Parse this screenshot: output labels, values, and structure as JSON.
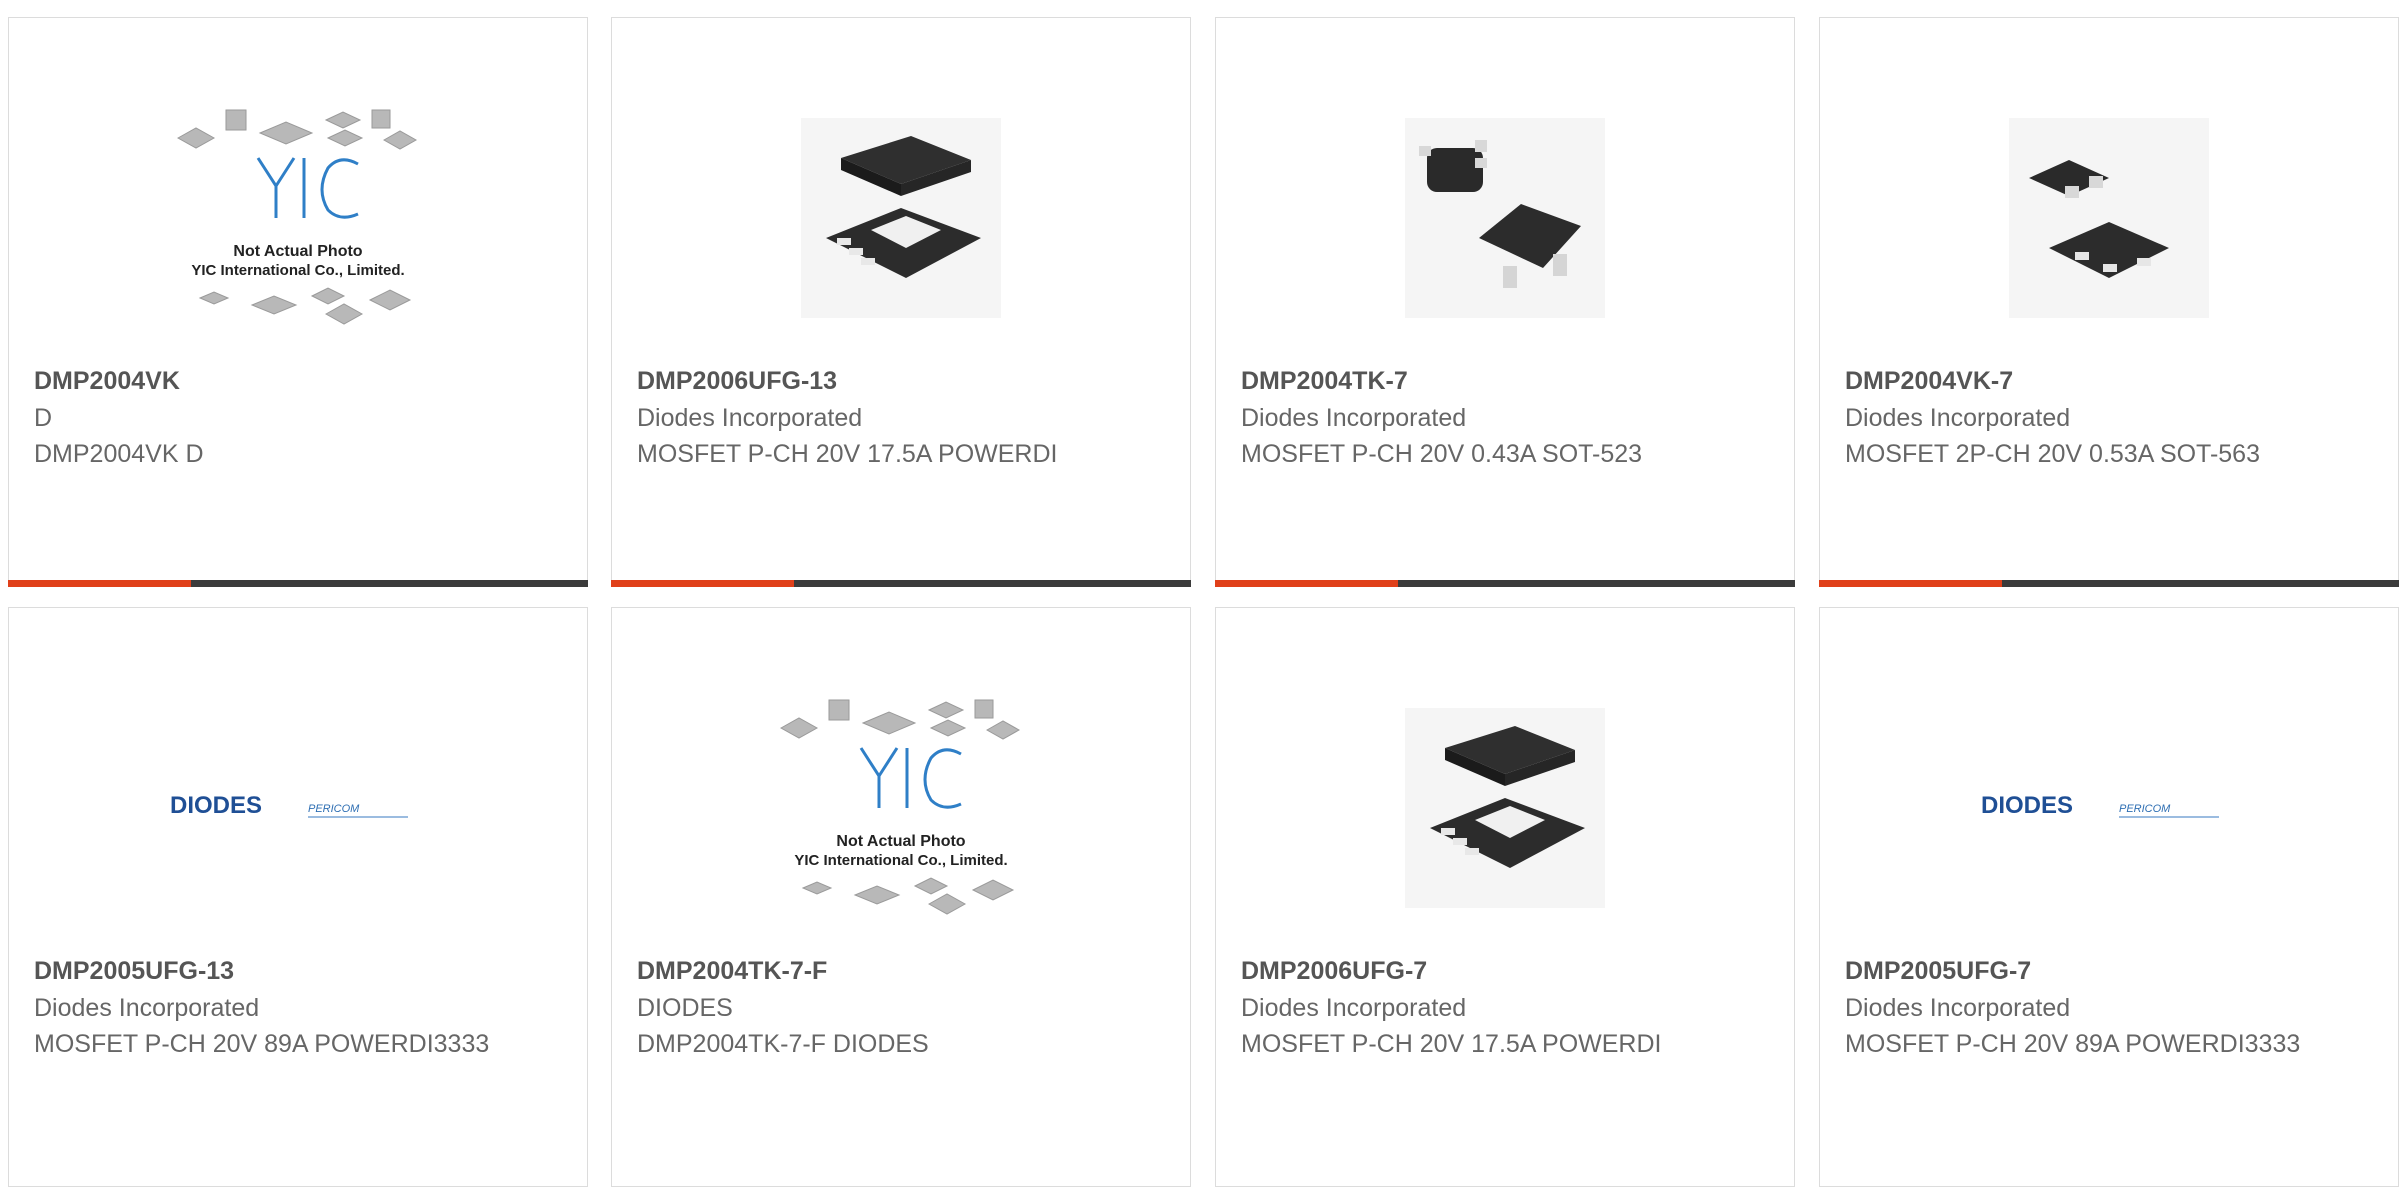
{
  "accent_color": "#e0401a",
  "bar_color": "#3b3b3b",
  "placeholder": {
    "brand": "YIC",
    "line1": "Not Actual Photo",
    "line2": "YIC International Co., Limited."
  },
  "logo": {
    "brand": "DIODES",
    "sub": "PERICOM"
  },
  "products": [
    {
      "part": "DMP2004VK",
      "mfr": "D",
      "desc": "DMP2004VK D",
      "image": "yic-placeholder"
    },
    {
      "part": "DMP2006UFG-13",
      "mfr": "Diodes Incorporated",
      "desc": "MOSFET P-CH 20V 17.5A POWERDI",
      "image": "powerdi-package"
    },
    {
      "part": "DMP2004TK-7",
      "mfr": "Diodes Incorporated",
      "desc": "MOSFET P-CH 20V 0.43A SOT-523",
      "image": "sot523-package"
    },
    {
      "part": "DMP2004VK-7",
      "mfr": "Diodes Incorporated",
      "desc": "MOSFET 2P-CH 20V 0.53A SOT-563",
      "image": "sot563-package"
    },
    {
      "part": "DMP2005UFG-13",
      "mfr": "Diodes Incorporated",
      "desc": "MOSFET P-CH 20V 89A POWERDI3333",
      "image": "diodes-logo"
    },
    {
      "part": "DMP2004TK-7-F",
      "mfr": "DIODES",
      "desc": "DMP2004TK-7-F DIODES",
      "image": "yic-placeholder"
    },
    {
      "part": "DMP2006UFG-7",
      "mfr": "Diodes Incorporated",
      "desc": "MOSFET P-CH 20V 17.5A POWERDI",
      "image": "powerdi-package"
    },
    {
      "part": "DMP2005UFG-7",
      "mfr": "Diodes Incorporated",
      "desc": "MOSFET P-CH 20V 89A POWERDI3333",
      "image": "diodes-logo"
    }
  ]
}
